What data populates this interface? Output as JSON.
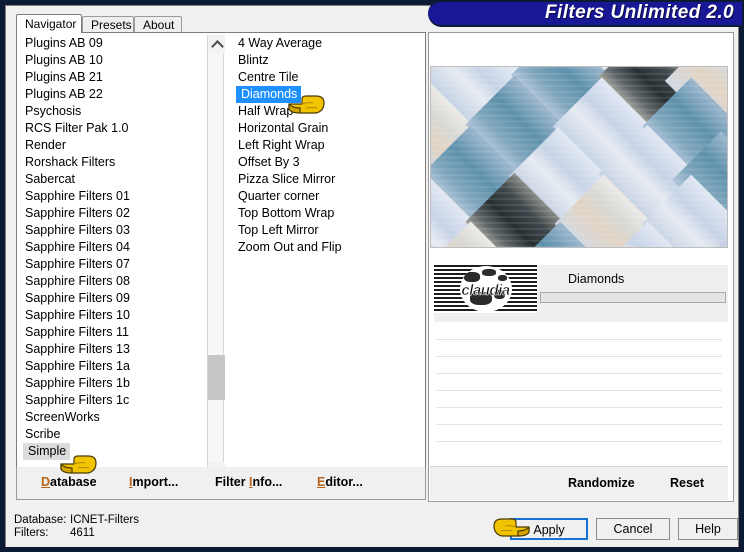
{
  "window": {
    "title": "Filters Unlimited 2.0"
  },
  "tabs": [
    {
      "label": "Navigator",
      "active": true
    },
    {
      "label": "Presets",
      "active": false
    },
    {
      "label": "About",
      "active": false
    }
  ],
  "categories": {
    "items": [
      "Plugins AB 09",
      "Plugins AB 10",
      "Plugins AB 21",
      "Plugins AB 22",
      "Psychosis",
      "RCS Filter Pak 1.0",
      "Render",
      "Rorshack Filters",
      "Sabercat",
      "Sapphire Filters 01",
      "Sapphire Filters 02",
      "Sapphire Filters 03",
      "Sapphire Filters 04",
      "Sapphire Filters 07",
      "Sapphire Filters 08",
      "Sapphire Filters 09",
      "Sapphire Filters 10",
      "Sapphire Filters 11",
      "Sapphire Filters 13",
      "Sapphire Filters 1a",
      "Sapphire Filters 1b",
      "Sapphire Filters 1c",
      "ScreenWorks",
      "Scribe",
      "Simple"
    ],
    "selected": "Simple",
    "selected_index": 24
  },
  "effects": {
    "items": [
      "4 Way Average",
      "Blintz",
      "Centre Tile",
      "Diamonds",
      "Half Wrap",
      "Horizontal Grain",
      "Left Right Wrap",
      "Offset By 3",
      "Pizza Slice Mirror",
      "Quarter corner",
      "Top Bottom Wrap",
      "Top Left Mirror",
      "Zoom Out and Flip"
    ],
    "selected": "Diamonds",
    "selected_index": 3
  },
  "menu": [
    {
      "label": "Database",
      "accel": "D",
      "rest": "atabase"
    },
    {
      "label": "Import...",
      "accel": "I",
      "rest": "mport..."
    },
    {
      "label": "Filter Info...",
      "pre": "Filter ",
      "accel": "I",
      "rest": "nfo..."
    },
    {
      "label": "Editor...",
      "accel": "E",
      "rest": "ditor..."
    }
  ],
  "parameters": {
    "logo_word": "claudia",
    "effect_name": "Diamonds"
  },
  "actions": {
    "randomize_label": "Randomize",
    "reset_label": "Reset"
  },
  "status": {
    "database_key": "Database:",
    "database_value": "ICNET-Filters",
    "filters_key": "Filters:",
    "filters_value": "4611"
  },
  "buttons": {
    "apply_label": "Apply",
    "cancel_label": "Cancel",
    "help_label": "Help"
  },
  "colors": {
    "title_bar": "#181896",
    "frame": "#0d1a33",
    "selection_blue": "#1e90ff",
    "selection_gray": "#dcdcdc",
    "accel_underline": "#b8641a",
    "focus_border": "#1673d2"
  }
}
